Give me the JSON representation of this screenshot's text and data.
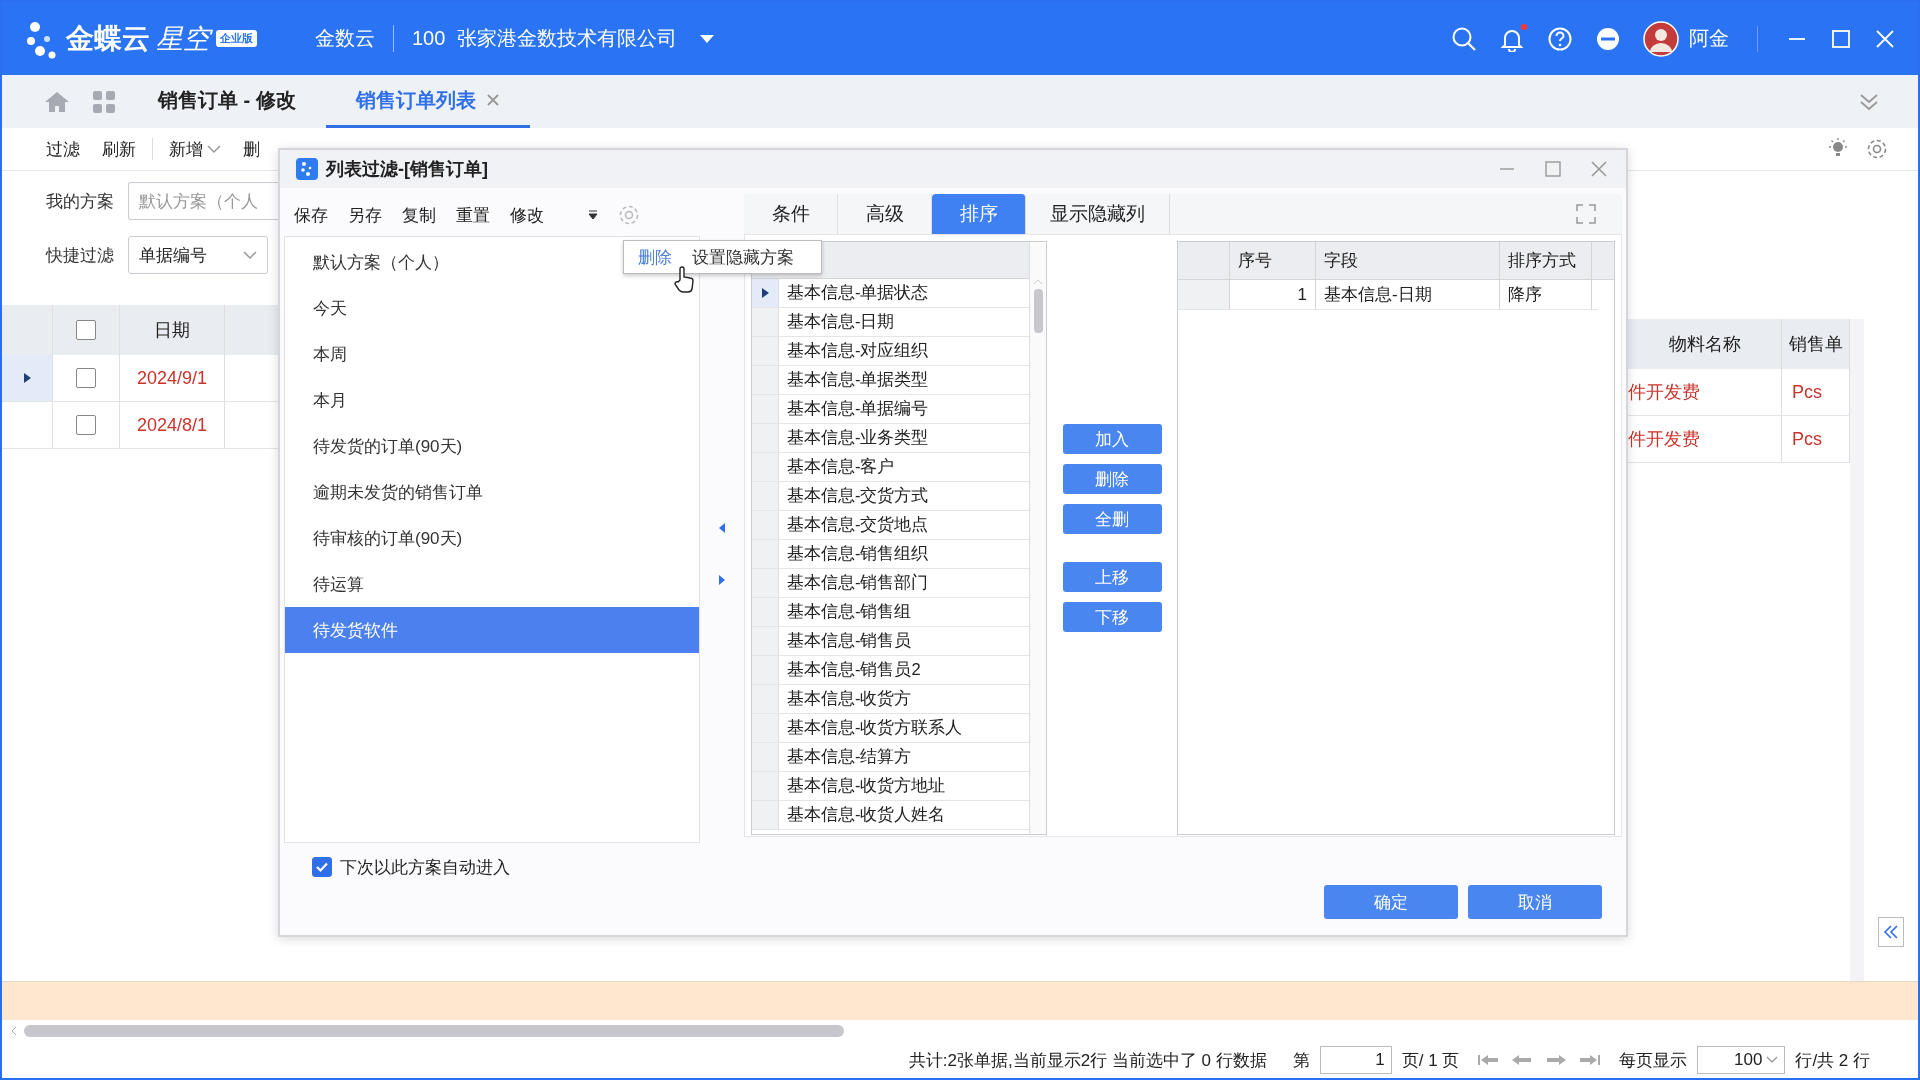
{
  "app_bar": {
    "brand": "金蝶云",
    "product": "星空",
    "edition": "企业版",
    "tenant": "金数云",
    "org_code": "100",
    "org_name": "张家港金数技术有限公司",
    "user": "阿金",
    "unread": true
  },
  "tabs": [
    {
      "label": "销售订单 - 修改",
      "selected": false,
      "closable": false
    },
    {
      "label": "销售订单列表",
      "selected": true,
      "closable": true
    }
  ],
  "toolbar": [
    {
      "label": "过滤",
      "dropdown": false
    },
    {
      "label": "刷新",
      "dropdown": false
    },
    {
      "label": "新增",
      "dropdown": true
    },
    {
      "label": "删",
      "dropdown": false
    }
  ],
  "filter": {
    "scheme_label": "我的方案",
    "scheme_value": "默认方案（个人",
    "quick_label": "快捷过滤",
    "quick_value": "单据编号"
  },
  "grid": {
    "select_all_checked": false,
    "left_columns": [
      "日期"
    ],
    "right_columns": [
      "物料名称",
      "销售单"
    ],
    "rows": [
      {
        "date": "2024/9/1",
        "material": "件开发费",
        "unit": "Pcs",
        "current": true,
        "checked": false
      },
      {
        "date": "2024/8/1",
        "material": "件开发费",
        "unit": "Pcs",
        "current": false,
        "checked": false
      }
    ]
  },
  "status_bar": {
    "summary": "共计:2张单据,当前显示2行 当前选中了 0 行数据",
    "page_prefix": "第",
    "page": "1",
    "page_suffix": "页/ 1 页",
    "per_page_label": "每页显示",
    "per_page": "100",
    "total": "行/共 2 行"
  },
  "dialog": {
    "title": "列表过滤-[销售订单]",
    "actions": [
      "保存",
      "另存",
      "复制",
      "重置",
      "修改"
    ],
    "more_menu": [
      {
        "label": "删除",
        "selected": true
      },
      {
        "label": "设置隐藏方案",
        "selected": false
      }
    ],
    "schemes": [
      {
        "label": "默认方案（个人）",
        "selected": false
      },
      {
        "label": "今天",
        "selected": false
      },
      {
        "label": "本周",
        "selected": false
      },
      {
        "label": "本月",
        "selected": false
      },
      {
        "label": "待发货的订单(90天)",
        "selected": false
      },
      {
        "label": "逾期未发货的销售订单",
        "selected": false
      },
      {
        "label": "待审核的订单(90天)",
        "selected": false
      },
      {
        "label": "待运算",
        "selected": false
      },
      {
        "label": "待发货软件",
        "selected": true
      }
    ],
    "tabs": [
      {
        "label": "条件",
        "selected": false
      },
      {
        "label": "高级",
        "selected": false
      },
      {
        "label": "排序",
        "selected": true
      },
      {
        "label": "显示隐藏列",
        "selected": false
      }
    ],
    "fields": [
      {
        "label": "基本信息-单据状态",
        "current": true
      },
      {
        "label": "基本信息-日期",
        "current": false
      },
      {
        "label": "基本信息-对应组织",
        "current": false
      },
      {
        "label": "基本信息-单据类型",
        "current": false
      },
      {
        "label": "基本信息-单据编号",
        "current": false
      },
      {
        "label": "基本信息-业务类型",
        "current": false
      },
      {
        "label": "基本信息-客户",
        "current": false
      },
      {
        "label": "基本信息-交货方式",
        "current": false
      },
      {
        "label": "基本信息-交货地点",
        "current": false
      },
      {
        "label": "基本信息-销售组织",
        "current": false
      },
      {
        "label": "基本信息-销售部门",
        "current": false
      },
      {
        "label": "基本信息-销售组",
        "current": false
      },
      {
        "label": "基本信息-销售员",
        "current": false
      },
      {
        "label": "基本信息-销售员2",
        "current": false
      },
      {
        "label": "基本信息-收货方",
        "current": false
      },
      {
        "label": "基本信息-收货方联系人",
        "current": false
      },
      {
        "label": "基本信息-结算方",
        "current": false
      },
      {
        "label": "基本信息-收货方地址",
        "current": false
      },
      {
        "label": "基本信息-收货人姓名",
        "current": false
      }
    ],
    "sort_buttons": [
      "加入",
      "删除",
      "全删",
      "上移",
      "下移"
    ],
    "sort_columns": [
      "序号",
      "字段",
      "排序方式"
    ],
    "sort_rows": [
      {
        "index": "1",
        "field": "基本信息-日期",
        "order": "降序"
      }
    ],
    "auto_enter": {
      "label": "下次以此方案自动进入",
      "checked": true
    },
    "footer_buttons": [
      "确定",
      "取消"
    ]
  }
}
